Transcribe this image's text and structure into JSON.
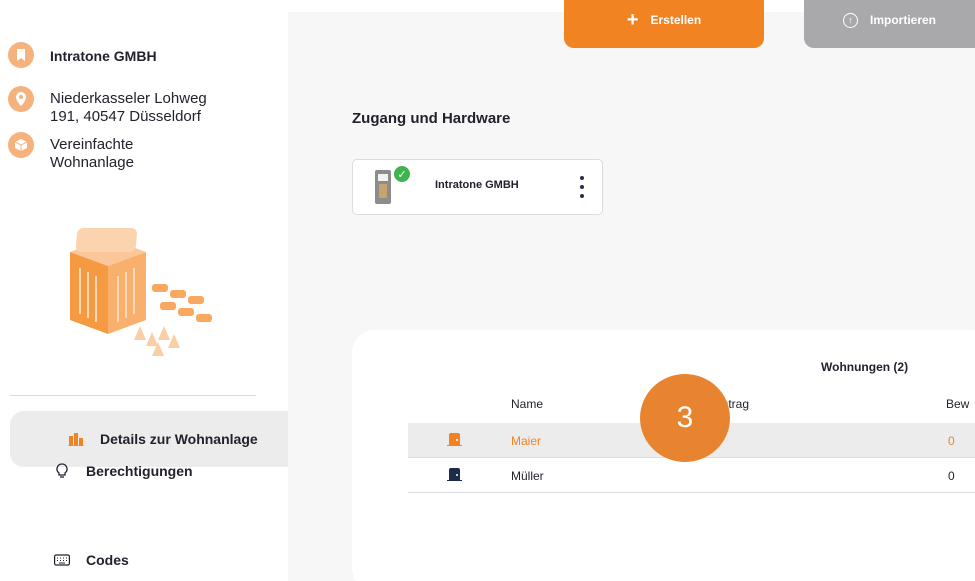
{
  "header": {
    "create_label": "Erstellen",
    "import_label": "Importieren"
  },
  "sidebar": {
    "company": "Intratone GMBH",
    "address_line1": "Niederkasseler Lohweg",
    "address_line2": "191, 40547 Düsseldorf",
    "type_line1": "Vereinfachte",
    "type_line2": "Wohnanlage",
    "nav": [
      {
        "label": "Details zur Wohnanlage",
        "icon": "building-icon",
        "active": true
      },
      {
        "label": "Berechtigungen",
        "icon": "lightbulb-icon",
        "active": false
      },
      {
        "label": "Codes",
        "icon": "keyboard-icon",
        "active": false
      }
    ]
  },
  "access": {
    "section_title": "Zugang und Hardware",
    "device_name": "Intratone GMBH"
  },
  "units": {
    "title": "Wohnungen (2)",
    "columns": {
      "name": "Name",
      "entry": "intrag",
      "residents": "Bew"
    },
    "rows": [
      {
        "name": "Maier",
        "residents": "0",
        "highlighted": true
      },
      {
        "name": "Müller",
        "residents": "0",
        "highlighted": false
      }
    ]
  },
  "step_badge": "3",
  "colors": {
    "accent": "#f28322",
    "icon_orange": "#f6b27c",
    "import_grey": "#a9a9ab",
    "door_navy": "#1e2a4a",
    "check_green": "#3fb34f"
  }
}
